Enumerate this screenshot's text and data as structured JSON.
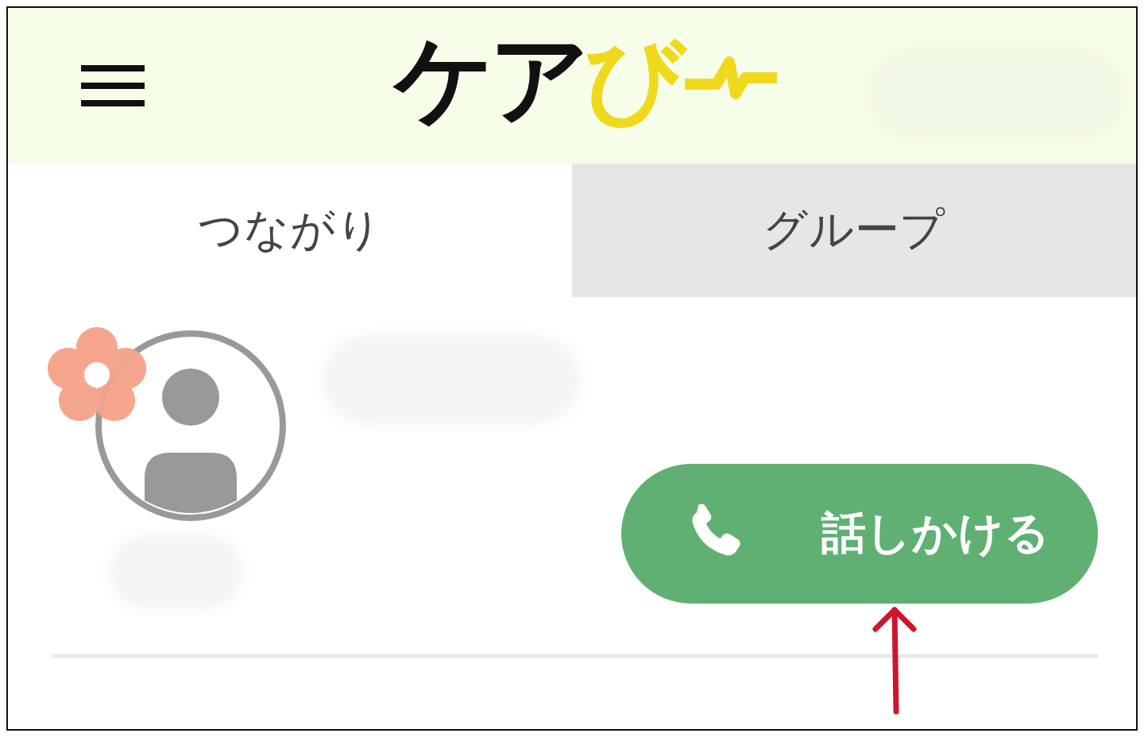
{
  "header": {
    "logo": {
      "dark_part": "ケア",
      "accent_part": "び"
    }
  },
  "tabs": [
    {
      "label": "つながり",
      "selected": true
    },
    {
      "label": "グループ",
      "selected": false
    }
  ],
  "contact": {
    "talk_button": "話しかける"
  }
}
